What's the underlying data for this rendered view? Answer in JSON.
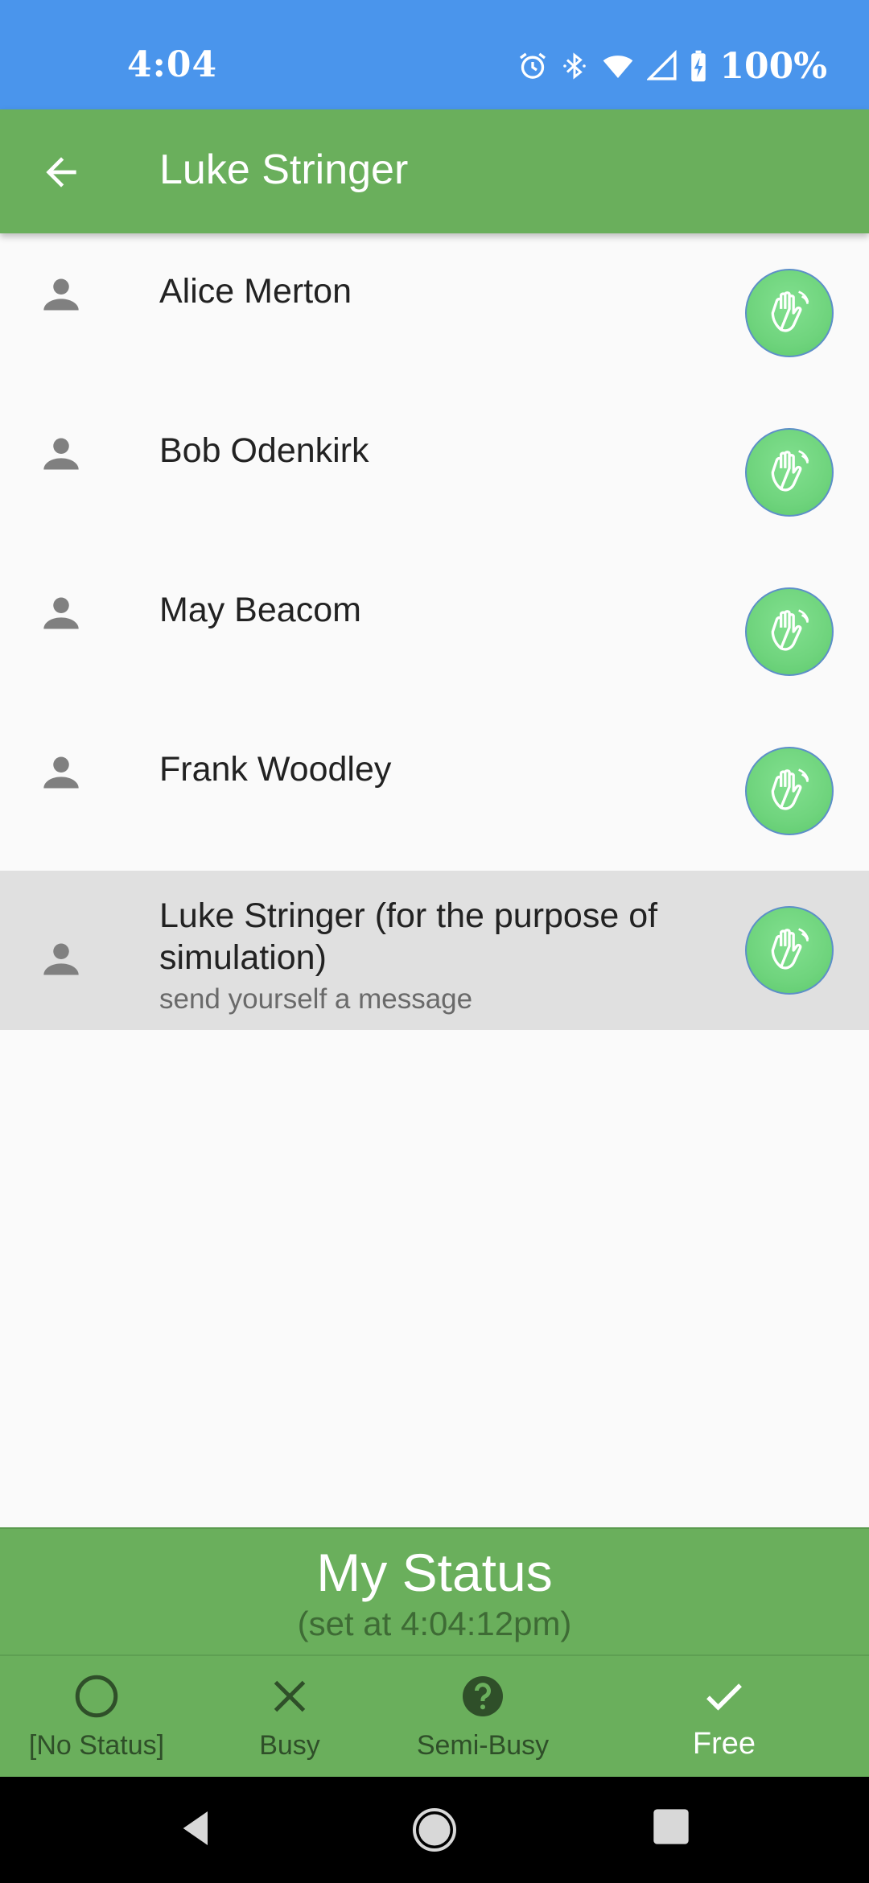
{
  "status_bar": {
    "time": "4:04",
    "battery": "100%",
    "icons": [
      "alarm-icon",
      "bluetooth-icon",
      "wifi-icon",
      "signal-icon",
      "battery-charging-icon"
    ]
  },
  "app_bar": {
    "title": "Luke Stringer",
    "back_icon": "arrow-left-icon"
  },
  "contacts": [
    {
      "name": "Alice Merton"
    },
    {
      "name": "Bob Odenkirk"
    },
    {
      "name": "May Beacom"
    },
    {
      "name": "Frank Woodley"
    },
    {
      "name": "Luke Stringer (for the purpose of simulation)",
      "subtitle": "send yourself a message"
    }
  ],
  "my_status": {
    "heading": "My Status",
    "set_at": "(set at 4:04:12pm)"
  },
  "status_options": [
    {
      "label": "[No Status]",
      "icon": "circle-outline-icon"
    },
    {
      "label": "Busy",
      "icon": "close-x-icon"
    },
    {
      "label": "Semi-Busy",
      "icon": "help-circle-icon"
    },
    {
      "label": "Free",
      "icon": "check-icon",
      "selected": true
    }
  ],
  "colors": {
    "status_bar": "#4a95ec",
    "app_bar": "#6aaf5c",
    "wave_button": "#6fd47d",
    "selected_row": "#e0e0e0"
  }
}
